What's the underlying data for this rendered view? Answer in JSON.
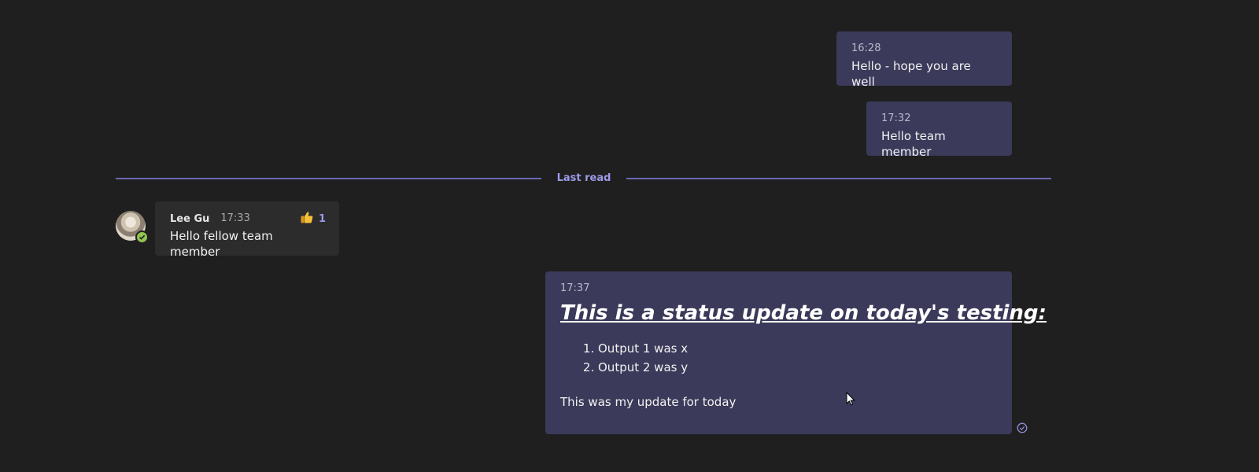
{
  "messages": {
    "m1": {
      "time": "16:28",
      "text": "Hello - hope you are well"
    },
    "m2": {
      "time": "17:32",
      "text": "Hello team member"
    },
    "m3": {
      "sender": "Lee Gu",
      "time": "17:33",
      "text": "Hello fellow team member",
      "reaction": {
        "icon": "thumbs-up-icon",
        "count": "1"
      }
    },
    "m4": {
      "time": "17:37",
      "heading": "This is a status update on today's testing:",
      "items": [
        "Output 1 was x",
        "Output 2 was y"
      ],
      "footer": "This was my update for today"
    }
  },
  "divider": {
    "label": "Last read"
  },
  "colors": {
    "background": "#1f1f1f",
    "own_bubble": "#3b3a5a",
    "other_bubble": "#2c2c2c",
    "accent": "#9c9ae8",
    "divider": "#6a68b0",
    "presence_available": "#92c353"
  }
}
